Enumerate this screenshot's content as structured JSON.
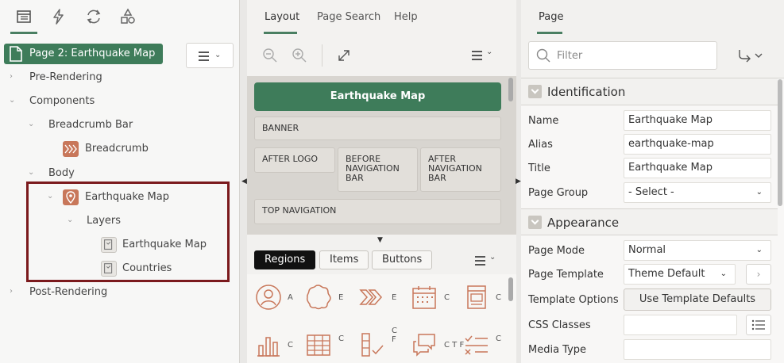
{
  "left": {
    "tabs": [
      {
        "icon": "rendering-tree-icon"
      },
      {
        "icon": "dynamic-actions-icon"
      },
      {
        "icon": "processing-icon"
      },
      {
        "icon": "shared-components-icon"
      }
    ],
    "page_chip": "Page 2: Earthquake Map",
    "tree": {
      "pre_rendering": "Pre-Rendering",
      "components": "Components",
      "breadcrumb_bar": "Breadcrumb Bar",
      "breadcrumb": "Breadcrumb",
      "body": "Body",
      "earthquake_map": "Earthquake Map",
      "layers": "Layers",
      "layer_1": "Earthquake Map",
      "layer_2": "Countries",
      "post_rendering": "Post-Rendering"
    }
  },
  "middle": {
    "tabs": [
      "Layout",
      "Page Search",
      "Help"
    ],
    "banner": "Earthquake Map",
    "slots": {
      "banner": "BANNER",
      "after_logo": "AFTER LOGO",
      "before_nav": "BEFORE NAVIGATION BAR",
      "after_nav": "AFTER NAVIGATION BAR",
      "top_nav": "TOP NAVIGATION"
    },
    "gallery_tabs": [
      "Regions",
      "Items",
      "Buttons"
    ],
    "gallery_labels": [
      "A",
      "E",
      "E",
      "C",
      "C",
      "C",
      "C",
      "C F",
      "C T F",
      "C",
      "C F"
    ]
  },
  "right": {
    "tab": "Page",
    "filter_placeholder": "Filter",
    "sections": {
      "identification": "Identification",
      "appearance": "Appearance"
    },
    "props": {
      "name_label": "Name",
      "name_value": "Earthquake Map",
      "alias_label": "Alias",
      "alias_value": "earthquake-map",
      "title_label": "Title",
      "title_value": "Earthquake Map",
      "page_group_label": "Page Group",
      "page_group_value": "- Select -",
      "page_mode_label": "Page Mode",
      "page_mode_value": "Normal",
      "page_template_label": "Page Template",
      "page_template_value": "Theme Default",
      "template_options_label": "Template Options",
      "template_options_button": "Use Template Defaults",
      "css_classes_label": "CSS Classes",
      "media_type_label": "Media Type"
    }
  },
  "colors": {
    "accent_green": "#3e7c5a",
    "highlight_red": "#7b1a1d",
    "region_icon": "#c8775a"
  }
}
